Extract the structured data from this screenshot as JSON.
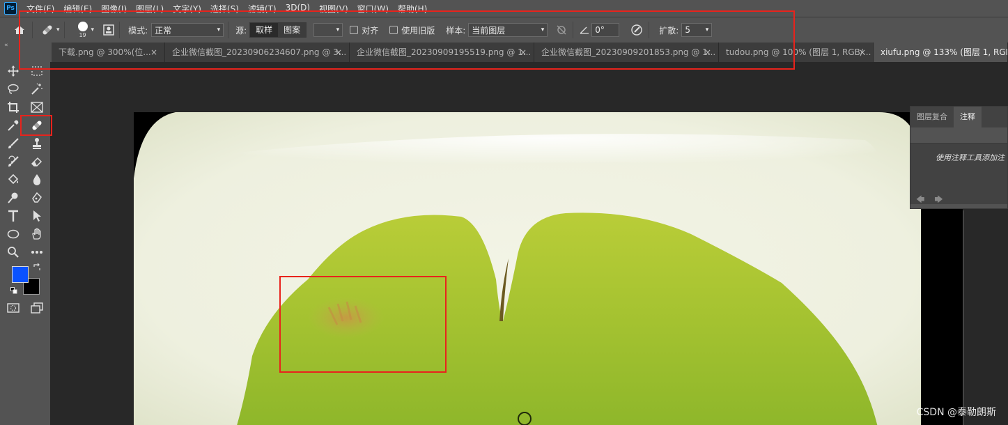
{
  "menubar": {
    "logo": "Ps",
    "items": [
      "文件(F)",
      "编辑(E)",
      "图像(I)",
      "图层(L)",
      "文字(Y)",
      "选择(S)",
      "滤镜(T)",
      "3D(D)",
      "视图(V)",
      "窗口(W)",
      "帮助(H)"
    ]
  },
  "options": {
    "brush_size": "19",
    "mode_label": "模式:",
    "mode_value": "正常",
    "source_label": "源:",
    "source_sampled": "取样",
    "source_pattern": "图案",
    "align_label": "对齐",
    "legacy_label": "使用旧版",
    "sample_label": "样本:",
    "sample_value": "当前图层",
    "angle_value": "0°",
    "diffusion_label": "扩散:",
    "diffusion_value": "5"
  },
  "tabs": [
    {
      "label": "下载.png @ 300%(位..."
    },
    {
      "label": "企业微信截图_20230906234607.png @ 3..."
    },
    {
      "label": "企业微信截图_20230909195519.png @ 1..."
    },
    {
      "label": "企业微信截图_20230909201853.png @ 1..."
    },
    {
      "label": "tudou.png @ 100% (图层 1, RGB/..."
    },
    {
      "label": "xiufu.png @ 133% (图层 1, RGB/8)"
    }
  ],
  "panel": {
    "tabs": [
      "图层复合",
      "注释"
    ],
    "hint": "使用注释工具添加注"
  },
  "colors": {
    "foreground": "#0a52ff",
    "background": "#000000",
    "highlight": "#e8231c"
  },
  "watermark": "CSDN @泰勒朗斯"
}
